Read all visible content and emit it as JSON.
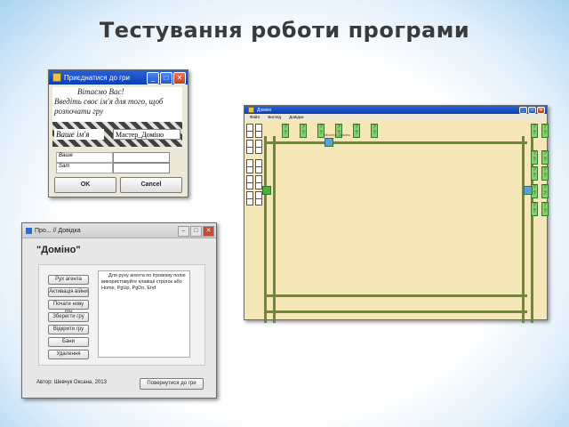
{
  "slide_title": "Тестування роботи програми",
  "join_dialog": {
    "title": "Приєднатися до гри",
    "greeting_lines": [
      "Вітаємо Вас!",
      "Введіть своє ім'я для того, щоб",
      "розпочати гру"
    ],
    "name_label": "Ваше ім'я",
    "name_value": "Мастер_Доміно",
    "row2_label": "Ваше",
    "row3_label": "Sam",
    "ok_label": "OK",
    "cancel_label": "Cancel"
  },
  "help_dialog": {
    "title": "Про... // Довідка",
    "heading": "\"Доміно\"",
    "buttons": [
      "Рух агента",
      "Активація війни",
      "Почати нову гру",
      "Зберегти гру",
      "Відкрити гру",
      "Бани",
      "Удалення"
    ],
    "help_text": "Для руху агента по ігровому полю використовуйте клавіші стрілок або Home, PgUp, PgDn, End",
    "author": "Автор: Шевчук Оксана, 2013",
    "return_button": "Повернутися до гри"
  },
  "game_window": {
    "title": "Доміно",
    "menu": [
      "Файл",
      "Вигляд",
      "Довідка"
    ],
    "cell_glyph": "?",
    "player_label": "Мастер_Доміно"
  },
  "colors": {
    "board": "#f5e7b8",
    "grid_line": "#6a8a3a",
    "cell": "#88d070"
  }
}
